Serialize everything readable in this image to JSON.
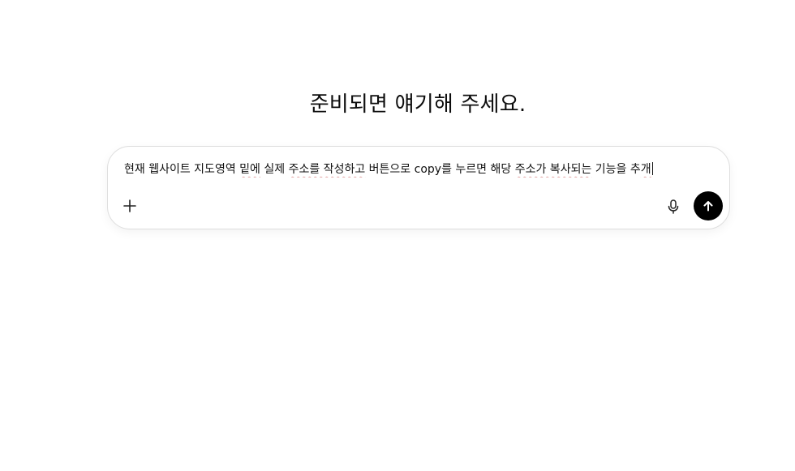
{
  "heading": "준비되면 얘기해 주세요.",
  "composer": {
    "text_parts": [
      {
        "text": "현재 웹사이트 지도영역 ",
        "spell": false
      },
      {
        "text": "밑에",
        "spell": true
      },
      {
        "text": " 실제 ",
        "spell": false
      },
      {
        "text": "주소를 작성하고",
        "spell": true
      },
      {
        "text": " 버튼으로 copy를 누르면 해당 ",
        "spell": false
      },
      {
        "text": "주소가 복사되는",
        "spell": true
      },
      {
        "text": " 기능을 추",
        "spell": false
      },
      {
        "text": "개",
        "spell": true
      }
    ]
  },
  "icons": {
    "plus": "plus-icon",
    "mic": "microphone-icon",
    "send": "arrow-up-icon"
  },
  "colors": {
    "send_button": "#000000",
    "spell_underline": "#e3a3a3"
  }
}
